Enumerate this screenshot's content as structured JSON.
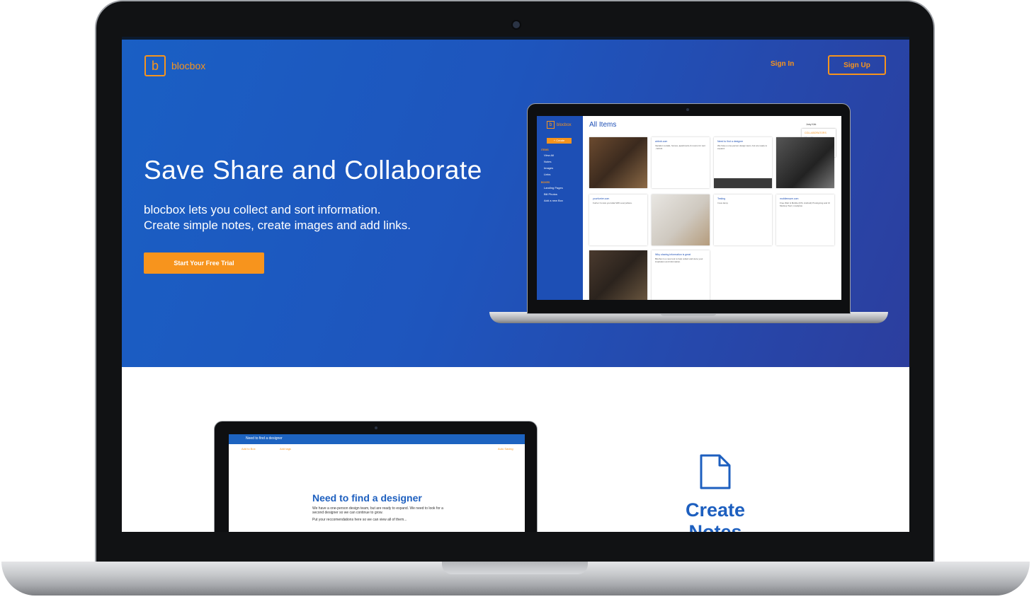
{
  "nav": {
    "brand": "blocbox",
    "logo_letter": "b",
    "sign_in": "Sign In",
    "sign_up": "Sign Up"
  },
  "hero": {
    "title": "Save Share and Collaborate",
    "subtitle_line1": "blocbox lets you collect and sort information.",
    "subtitle_line2": "Create simple notes, create images and add links.",
    "cta": "Start Your Free Trial"
  },
  "app_preview": {
    "brand": "blocbox",
    "create": "+ Create",
    "section_items": "ITEMS",
    "items": [
      "View All",
      "Notes",
      "Images",
      "Links"
    ],
    "section_boxes": "BOXES",
    "boxes": [
      "Landing Pages",
      "Bill Photos",
      "Add a new Box"
    ],
    "title": "All Items",
    "user": "Joey Kirk",
    "collab": {
      "header": "COLLABORATORS",
      "view_all": "View All",
      "create_group": "Create a Group",
      "share": "Share"
    },
    "cards": {
      "airbnb_title": "airbnb.com",
      "airbnb_body": "Vacation rentals, homes, apartments & rooms for rent - Airbnb",
      "designer_title": "Need to find a designer",
      "designer_body": "We have a one-person design team, but are ready to expand.",
      "yourfurrier_title": "yourfurrier.com",
      "yourfurrier_body": "Furrier Co lets you label WiFi everywhere.",
      "testing_title": "Testing",
      "testing_body": "I love lamp.",
      "mockup_title": "mobilemaze.com",
      "mockup_body": "Free Web & Mobile (iOS, Android) Prototyping and UI Mockup Tool | mockplus",
      "sharing_title": "Why sharing information is great",
      "sharing_body": "Blocbox is a new tool to help collect and store your inspiration and information."
    }
  },
  "note_preview": {
    "bar_title": "Need to find a designer",
    "add_to_box": "Add to Box",
    "add_tags": "Add tags",
    "autosaving": "Auto Saving",
    "heading": "Need to find a designer",
    "body1": "We have a one-person design team, but are ready to expand. We need to look for a second designer so we can continue to grow.",
    "body2": "Put your reccomendations here so we can view all of them..."
  },
  "feature": {
    "title": "Create Notes",
    "icon": "document-icon"
  },
  "colors": {
    "accent": "#f7941d",
    "primary": "#1d5fbf"
  }
}
